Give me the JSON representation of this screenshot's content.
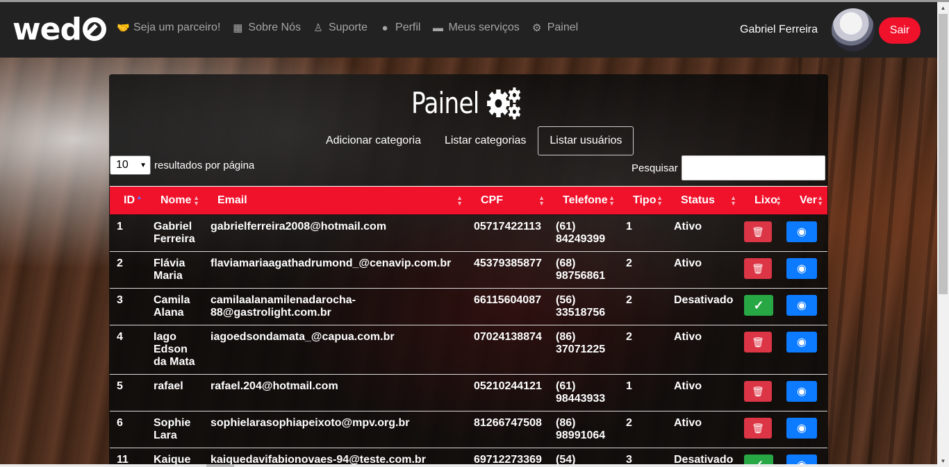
{
  "navbar": {
    "logo": "wed",
    "links": [
      {
        "label": "Seja um parceiro!",
        "icon": "handshake-icon"
      },
      {
        "label": "Sobre Nós",
        "icon": "building-icon"
      },
      {
        "label": "Suporte",
        "icon": "user-tie-icon"
      },
      {
        "label": "Perfil",
        "icon": "user-circle-icon"
      },
      {
        "label": "Meus serviços",
        "icon": "toolbox-icon"
      },
      {
        "label": "Painel",
        "icon": "gears-icon"
      }
    ],
    "user_name": "Gabriel Ferreira",
    "logout_label": "Sair"
  },
  "panel": {
    "title": "Painel",
    "tabs": [
      {
        "label": "Adicionar categoria",
        "active": false
      },
      {
        "label": "Listar categorias",
        "active": false
      },
      {
        "label": "Listar usuários",
        "active": true
      }
    ],
    "page_length": {
      "value": "10",
      "label": "resultados por página"
    },
    "search": {
      "label": "Pesquisar",
      "value": ""
    }
  },
  "table": {
    "headers": [
      "ID",
      "Nome",
      "Email",
      "CPF",
      "Telefone",
      "Tipo",
      "Status",
      "Lixo",
      "Ver"
    ],
    "rows": [
      {
        "id": "1",
        "nome": [
          "Gabriel",
          "Ferreira"
        ],
        "email": [
          "gabrielferreira2008@hotmail.com"
        ],
        "cpf": "05717422113",
        "tel": [
          "(61)",
          "84249399"
        ],
        "tipo": "1",
        "status": "Ativo",
        "action": "delete"
      },
      {
        "id": "2",
        "nome": [
          "Flávia",
          "Maria"
        ],
        "email": [
          "flaviamariaagathadrumond_@cenavip.com.br"
        ],
        "cpf": "45379385877",
        "tel": [
          "(68)",
          "98756861"
        ],
        "tipo": "2",
        "status": "Ativo",
        "action": "delete"
      },
      {
        "id": "3",
        "nome": [
          "Camila",
          "Alana"
        ],
        "email": [
          "camilaalanamilenadarocha-",
          "88@gastrolight.com.br"
        ],
        "cpf": "66115604087",
        "tel": [
          "(56)",
          "33518756"
        ],
        "tipo": "2",
        "status": "Desativado",
        "action": "activate"
      },
      {
        "id": "4",
        "nome": [
          "Iago",
          "Edson",
          "da Mata"
        ],
        "email": [
          "iagoedsondamata_@capua.com.br"
        ],
        "cpf": "07024138874",
        "tel": [
          "(86)",
          "37071225"
        ],
        "tipo": "2",
        "status": "Ativo",
        "action": "delete"
      },
      {
        "id": "5",
        "nome": [
          "rafael"
        ],
        "email": [
          "rafael.204@hotmail.com"
        ],
        "cpf": "05210244121",
        "tel": [
          "(61)",
          "98443933"
        ],
        "tipo": "1",
        "status": "Ativo",
        "action": "delete"
      },
      {
        "id": "6",
        "nome": [
          "Sophie",
          "Lara"
        ],
        "email": [
          "sophielarasophiapeixoto@mpv.org.br"
        ],
        "cpf": "81266747508",
        "tel": [
          "(86)",
          "98991064"
        ],
        "tipo": "2",
        "status": "Ativo",
        "action": "delete"
      },
      {
        "id": "11",
        "nome": [
          "Kaique"
        ],
        "email": [
          "kaiquedavifabionovaes-94@teste.com.br"
        ],
        "cpf": "69712273369",
        "tel": [
          "(54)"
        ],
        "tipo": "3",
        "status": "Desativado",
        "action": "activate"
      }
    ]
  },
  "colors": {
    "navbar_bg": "#222222",
    "accent_red": "#f0112b",
    "delete_red": "#dc3545",
    "activate_green": "#28a745",
    "view_blue": "#0d7bff"
  }
}
